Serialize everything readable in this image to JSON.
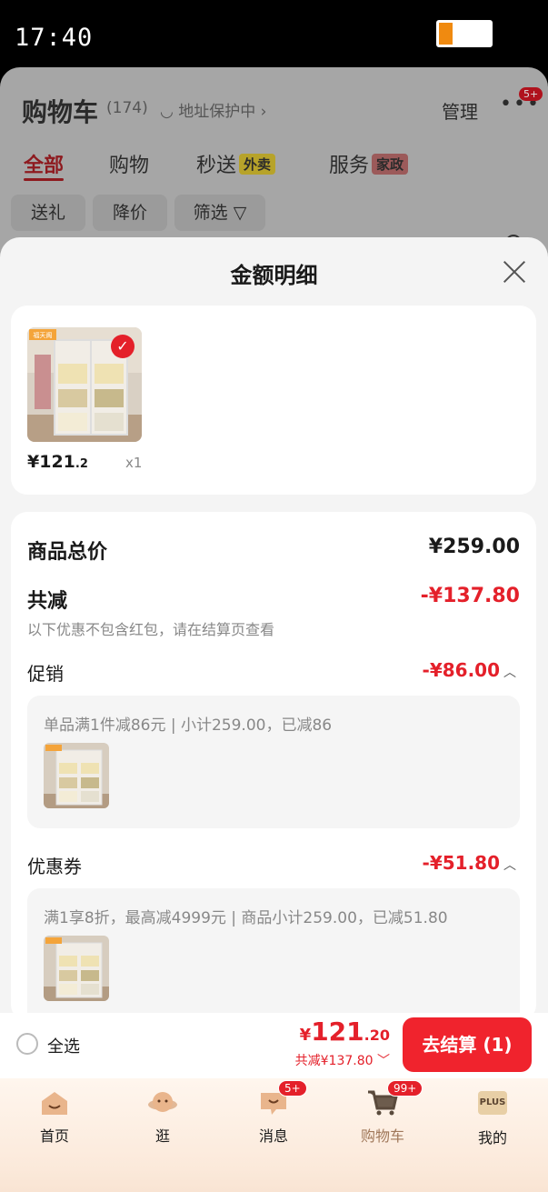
{
  "status_bar": {
    "time": "17:40",
    "battery_level": 0.25
  },
  "background_page": {
    "title": "购物车",
    "count": "(174)",
    "address": "地址保护中 ›",
    "manage": "管理",
    "more": "•••",
    "more_badge": "5+",
    "tabs": [
      {
        "label": "全部",
        "tag": ""
      },
      {
        "label": "购物",
        "tag": ""
      },
      {
        "label": "秒送",
        "tag": "外卖"
      },
      {
        "label": "服务",
        "tag": "家政"
      }
    ],
    "chips": [
      "送礼",
      "降价",
      "筛选 ▽"
    ]
  },
  "sheet": {
    "title": "金额明细",
    "item": {
      "price_main": "¥121",
      "price_dec": ".2",
      "qty": "x1",
      "brand_tag": "福天阁"
    },
    "summary": {
      "total_label": "商品总价",
      "total_value": "¥259.00",
      "discount_label": "共减",
      "discount_value": "-¥137.80",
      "discount_note": "以下优惠不包含红包，请在结算页查看",
      "promo_label": "促销",
      "promo_value": "-¥86.00",
      "promo_detail": "单品满1件减86元 | 小计259.00，已减86",
      "coupon_label": "优惠券",
      "coupon_value": "-¥51.80",
      "coupon_detail": "满1享8折，最高减4999元 | 商品小计259.00，已减51.80"
    }
  },
  "checkout_bar": {
    "select_all": "全选",
    "currency": "¥",
    "total_main": "121",
    "total_dec": ".20",
    "saved": "共减¥137.80",
    "checkout_button": "去结算 (1)"
  },
  "tab_bar": [
    {
      "label": "首页",
      "icon": "home-icon",
      "badge": ""
    },
    {
      "label": "逛",
      "icon": "browse-icon",
      "badge": ""
    },
    {
      "label": "消息",
      "icon": "message-icon",
      "badge": "5+"
    },
    {
      "label": "购物车",
      "icon": "cart-icon",
      "badge": "99+"
    },
    {
      "label": "我的",
      "icon": "plus-icon",
      "badge": "",
      "icon_text": "PLUS"
    }
  ],
  "colors": {
    "accent": "#e4202a",
    "checkout_button": "#f0232d"
  }
}
